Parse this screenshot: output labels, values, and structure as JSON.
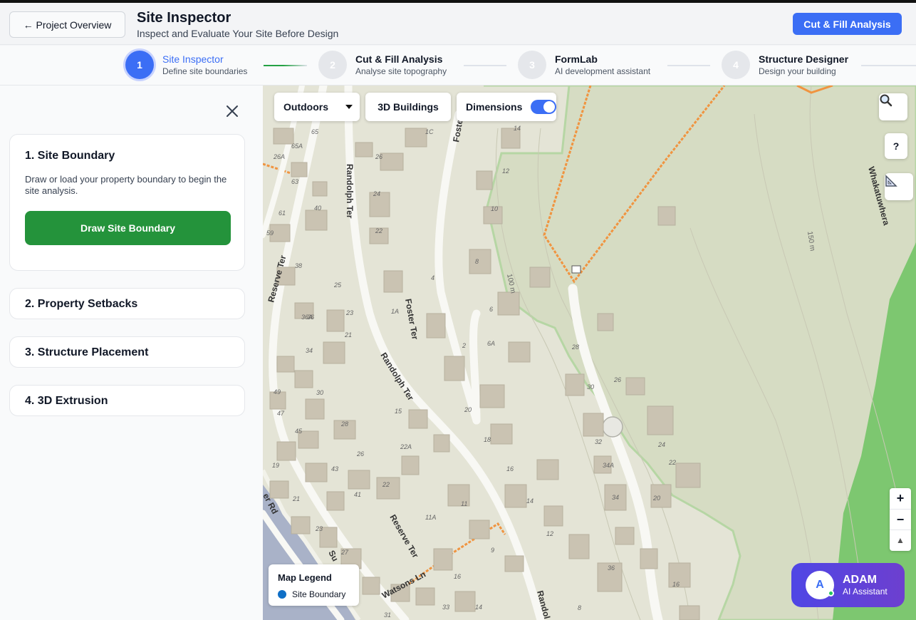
{
  "header": {
    "back_label": "← Project Overview",
    "title": "Site Inspector",
    "subtitle": "Inspect and Evaluate Your Site Before Design",
    "cta_label": "Cut & Fill Analysis"
  },
  "steps": [
    {
      "number": "1",
      "title": "Site Inspector",
      "desc": "Define site boundaries",
      "active": true
    },
    {
      "number": "2",
      "title": "Cut & Fill Analysis",
      "desc": "Analyse site topography",
      "active": false
    },
    {
      "number": "3",
      "title": "FormLab",
      "desc": "AI development assistant",
      "active": false
    },
    {
      "number": "4",
      "title": "Structure Designer",
      "desc": "Design your building",
      "active": false
    }
  ],
  "sidebar": {
    "sections": [
      {
        "title": "1. Site Boundary",
        "desc": "Draw or load your property boundary to begin the site analysis.",
        "button": "Draw Site Boundary",
        "expanded": true
      },
      {
        "title": "2. Property Setbacks",
        "expanded": false
      },
      {
        "title": "3. Structure Placement",
        "expanded": false
      },
      {
        "title": "4. 3D Extrusion",
        "expanded": false
      }
    ]
  },
  "map": {
    "style_value": "Outdoors",
    "buildings_label": "3D Buildings",
    "dimensions_label": "Dimensions",
    "dimensions_on": true,
    "legend_title": "Map Legend",
    "legend_item": "Site Boundary",
    "legend_color": "#0f6fc6",
    "street_labels": [
      "Randolph Ter",
      "Foster Ter",
      "Reserve Ter",
      "Whakatuwhera",
      "Watsons Ln",
      "Randolph Ter",
      "Foster Ter",
      "Reserve Ter",
      "Randol",
      "er Rd",
      "Su"
    ],
    "contour_labels": [
      "100 m",
      "150 m"
    ],
    "house_numbers": [
      "65",
      "65A",
      "1C",
      "26A",
      "26",
      "63",
      "24",
      "61",
      "40",
      "22",
      "59",
      "14",
      "12",
      "10",
      "38",
      "25",
      "8",
      "4",
      "36",
      "36A",
      "23",
      "1A",
      "6",
      "21",
      "34",
      "2",
      "6A",
      "28",
      "30",
      "26",
      "49",
      "30",
      "20",
      "15",
      "47",
      "28",
      "18",
      "32",
      "24",
      "45",
      "22A",
      "26",
      "16",
      "34A",
      "22",
      "19",
      "43",
      "22",
      "20",
      "34",
      "21",
      "41",
      "11",
      "14",
      "11A",
      "12",
      "23",
      "9",
      "16",
      "27",
      "36",
      "16",
      "33",
      "14",
      "8",
      "31"
    ]
  },
  "tools": {
    "search_icon": "magnifier-icon",
    "help_label": "?",
    "measure_icon": "ruler-triangle-icon",
    "zoom_in": "+",
    "zoom_out": "−",
    "compass": "▲"
  },
  "assistant": {
    "avatar_letter": "A",
    "name": "ADAM",
    "role": "AI Assistant"
  },
  "colors": {
    "accent": "#3b6ef5",
    "draw_button": "#24933b",
    "park": "#7dc770",
    "land": "#e4e4d6",
    "road_line": "#f09440"
  }
}
